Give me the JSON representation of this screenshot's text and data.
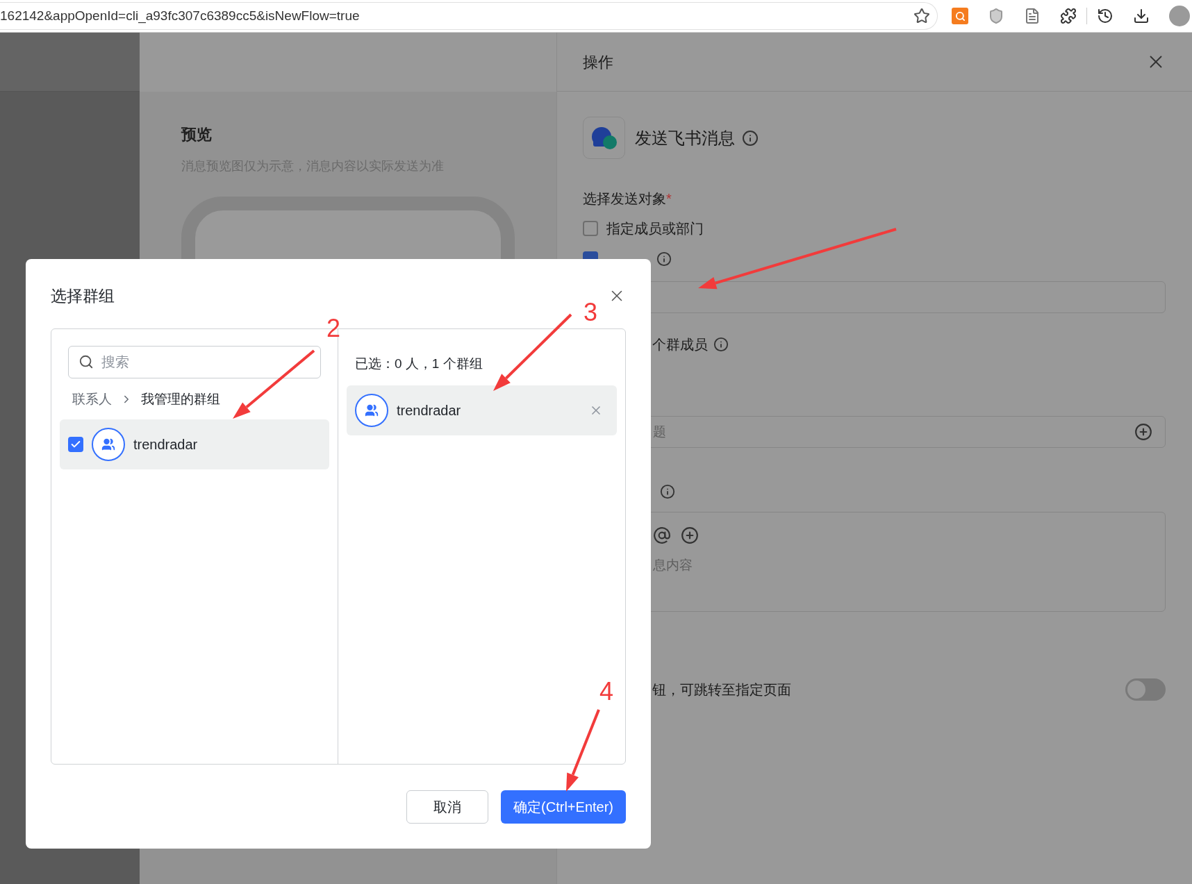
{
  "browser": {
    "url": "162142&appOpenId=cli_a93fc307c6389cc5&isNewFlow=true"
  },
  "preview": {
    "title": "预览",
    "subtitle": "消息预览图仅为示意，消息内容以实际发送为准"
  },
  "panel": {
    "title": "操作",
    "action": {
      "title": "发送飞书消息"
    },
    "recipients": {
      "label": "选择发送对象",
      "required_mark": "*",
      "options": [
        {
          "label": "指定成员或部门",
          "checked": false
        },
        {
          "checked": true
        }
      ]
    },
    "member_note": "个群成员",
    "title_field": {
      "placeholder": "题"
    },
    "content_field": {
      "placeholder": "息内容"
    },
    "button_toggle": {
      "label": "钮，可跳转至指定页面",
      "on": false
    }
  },
  "dialog": {
    "title": "选择群组",
    "search": {
      "placeholder": "搜索"
    },
    "breadcrumb": [
      "联系人",
      "我管理的群组"
    ],
    "groups": [
      {
        "name": "trendradar",
        "checked": true
      }
    ],
    "selected_summary": "已选：0 人，1 个群组",
    "selected": [
      {
        "name": "trendradar"
      }
    ],
    "buttons": [
      {
        "label": "取消",
        "kind": "secondary"
      },
      {
        "label": "确定(Ctrl+Enter)",
        "kind": "primary"
      }
    ]
  },
  "annotations": [
    "2",
    "3",
    "4"
  ]
}
